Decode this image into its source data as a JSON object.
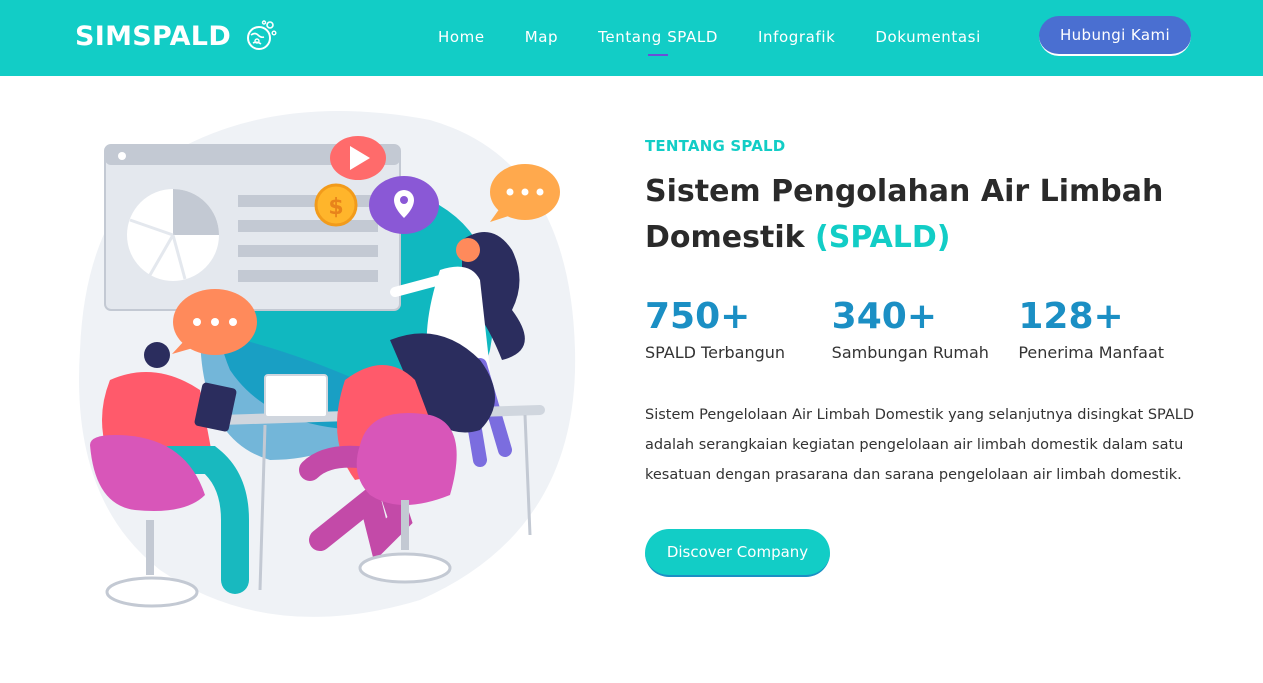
{
  "header": {
    "brand": "SIMSPALD",
    "brand_icon": "globe-bubbles-icon",
    "nav": [
      {
        "label": "Home",
        "active": false
      },
      {
        "label": "Map",
        "active": false
      },
      {
        "label": "Tentang SPALD",
        "active": true
      },
      {
        "label": "Infografik",
        "active": false
      },
      {
        "label": "Dokumentasi",
        "active": false
      }
    ],
    "contact_label": "Hubungi Kami"
  },
  "hero": {
    "eyebrow": "TENTANG SPALD",
    "title_main": "Sistem Pengolahan Air Limbah Domestik",
    "title_accent": "(SPALD)",
    "stats": [
      {
        "value": "750+",
        "label": "SPALD Terbangun"
      },
      {
        "value": "340+",
        "label": "Sambungan Rumah"
      },
      {
        "value": "128+",
        "label": "Penerima Manfaat"
      }
    ],
    "description": "Sistem Pengelolaan Air Limbah Domestik yang selanjutnya disingkat SPALD adalah serangkaian kegiatan pengelolaan air limbah domestik dalam satu kesatuan dengan prasarana dan sarana pengelolaan air limbah domestik.",
    "cta_label": "Discover Company",
    "illustration_dollar": "$"
  },
  "colors": {
    "navbar": "#12cdc6",
    "accent": "#12cdc6",
    "stat_blue": "#1b8fc4",
    "contact_button": "#4a6fd1",
    "nav_underline": "#6a4fd8",
    "text_dark": "#2a2a2a"
  }
}
